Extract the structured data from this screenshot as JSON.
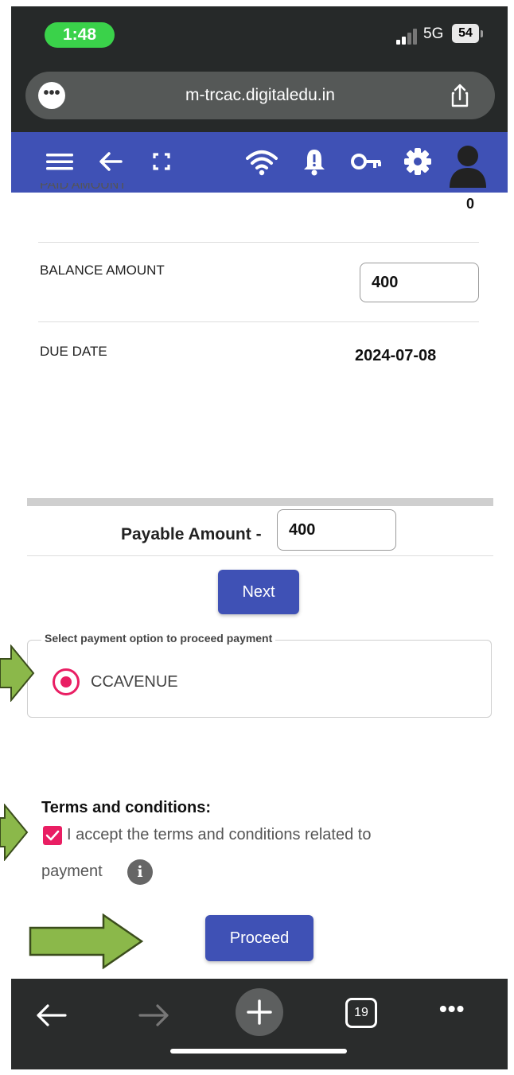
{
  "status_bar": {
    "time": "1:48",
    "network": "5G",
    "battery": "54"
  },
  "browser": {
    "url": "m-trcac.digitaledu.in",
    "tab_count": "19"
  },
  "fee_details": {
    "partial_label": "PAID AMOUNT",
    "partial_value": "0",
    "balance_label": "BALANCE AMOUNT",
    "balance_value": "400",
    "due_label": "DUE DATE",
    "due_value": "2024-07-08"
  },
  "payable": {
    "label": "Payable Amount -",
    "value": "400"
  },
  "next_label": "Next",
  "payment_options": {
    "legend": "Select payment option to proceed payment",
    "selected": "CCAVENUE"
  },
  "terms": {
    "title": "Terms and conditions:",
    "line1": "I accept the terms and conditions related to",
    "line2": "payment",
    "accepted": true
  },
  "proceed_label": "Proceed",
  "colors": {
    "primary": "#3f51b5",
    "accent": "#e91e63",
    "status_green": "#3ad24a",
    "annotation_arrow": "#8bb84a"
  }
}
